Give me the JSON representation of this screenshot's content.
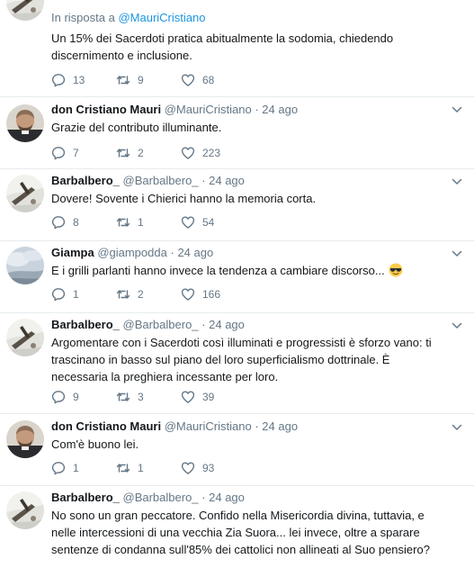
{
  "tweets": [
    {
      "reply_prefix": "In risposta a",
      "reply_handle": "@MauriCristiano",
      "text": "Un 15% dei Sacerdoti pratica abitualmente la sodomia, chiedendo discernimento e inclusione.",
      "replies": "13",
      "retweets": "9",
      "likes": "68"
    },
    {
      "name": "don Cristiano Mauri",
      "handle": "@MauriCristiano",
      "time": "24 ago",
      "text": "Grazie del contributo illuminante.",
      "replies": "7",
      "retweets": "2",
      "likes": "223"
    },
    {
      "name": "Barbalbero_",
      "handle": "@Barbalbero_",
      "time": "24 ago",
      "text": "Dovere! Sovente i Chierici hanno la memoria corta.",
      "replies": "8",
      "retweets": "1",
      "likes": "54"
    },
    {
      "name": "Giampa",
      "handle": "@giampodda",
      "time": "24 ago",
      "text": "E i grilli parlanti hanno invece la tendenza a cambiare discorso...",
      "emoji": "sunglasses-emoji",
      "replies": "1",
      "retweets": "2",
      "likes": "166"
    },
    {
      "name": "Barbalbero_",
      "handle": "@Barbalbero_",
      "time": "24 ago",
      "text": "Argomentare con i Sacerdoti così illuminati e progressisti è sforzo vano: ti trascinano in basso sul piano del loro superficialismo dottrinale. È necessaria la preghiera incessante per loro.",
      "replies": "9",
      "retweets": "3",
      "likes": "39"
    },
    {
      "name": "don Cristiano Mauri",
      "handle": "@MauriCristiano",
      "time": "24 ago",
      "text": "Com'è buono lei.",
      "replies": "1",
      "retweets": "1",
      "likes": "93"
    },
    {
      "name": "Barbalbero_",
      "handle": "@Barbalbero_",
      "time": "24 ago",
      "text": "No sono un gran peccatore. Confido nella Misericordia divina, tuttavia, e nelle intercessioni di una vecchia Zia Suora... lei invece, oltre a sparare sentenze di condanna sull'85% dei cattolici non allineati al Suo pensiero?"
    }
  ],
  "dot": "·",
  "colors": {
    "link": "#1b95e0",
    "secondary": "#657786",
    "divider": "#e6ecf0"
  }
}
